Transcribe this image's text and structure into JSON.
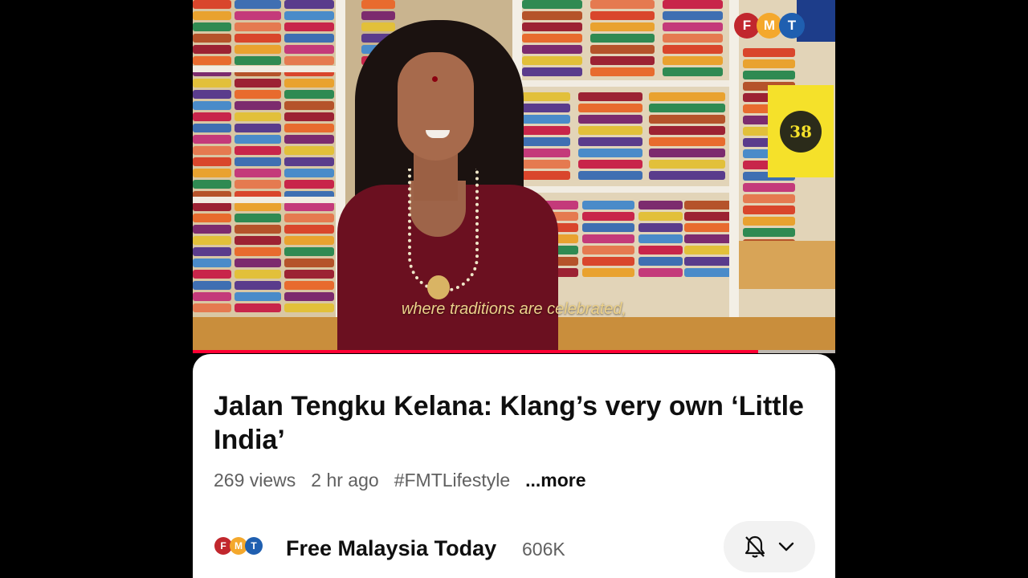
{
  "video": {
    "caption": "where traditions are celebrated,",
    "watermark": [
      "F",
      "M",
      "T"
    ],
    "price_tag_text": "38",
    "progress": 0.88
  },
  "logo_colors": [
    "#c1272d",
    "#f4a82c",
    "#1f5fb0"
  ],
  "details": {
    "title": "Jalan Tengku Kelana: Klang’s very own ‘Little India’",
    "views": "269 views",
    "age": "2 hr ago",
    "hashtag": "#FMTLifestyle",
    "more_label": "...more"
  },
  "channel": {
    "logo": [
      "F",
      "M",
      "T"
    ],
    "name": "Free Malaysia Today",
    "subscribers": "606K",
    "bell_icon": "bell-off-icon",
    "chevron_icon": "chevron-down-icon"
  }
}
